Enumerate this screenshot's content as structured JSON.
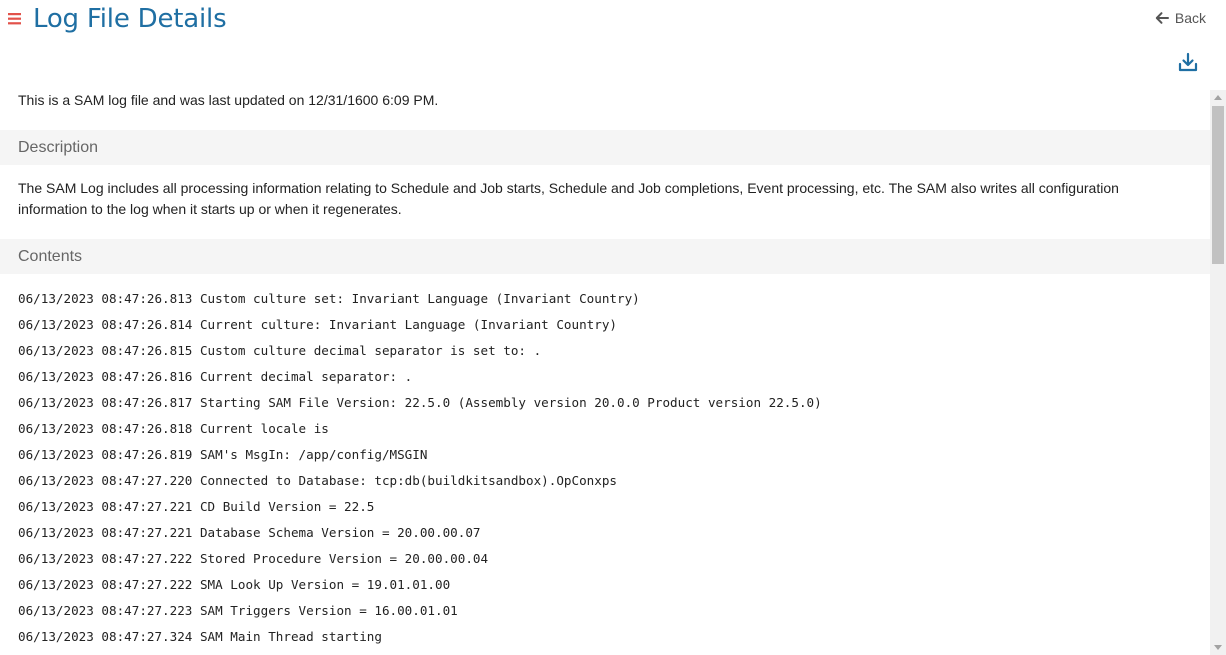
{
  "header": {
    "title": "Log File Details",
    "back_label": "Back",
    "title_color": "#1f6fa3",
    "menu_color": "#e2524a"
  },
  "summary": "This is a SAM log file and was last updated on 12/31/1600 6:09 PM.",
  "description": {
    "heading": "Description",
    "text": "The SAM Log includes all processing information relating to Schedule and Job starts, Schedule and Job completions, Event processing, etc. The SAM also writes all configuration information to the log when it starts up or when it regenerates."
  },
  "contents": {
    "heading": "Contents",
    "lines": [
      "06/13/2023 08:47:26.813 Custom culture set: Invariant Language (Invariant Country)",
      "06/13/2023 08:47:26.814 Current culture: Invariant Language (Invariant Country)",
      "06/13/2023 08:47:26.815 Custom culture decimal separator is set to: .",
      "06/13/2023 08:47:26.816 Current decimal separator: .",
      "06/13/2023 08:47:26.817 Starting SAM File Version: 22.5.0 (Assembly version 20.0.0 Product version 22.5.0)",
      "06/13/2023 08:47:26.818 Current locale is",
      "06/13/2023 08:47:26.819 SAM's MsgIn: /app/config/MSGIN",
      "06/13/2023 08:47:27.220 Connected to Database: tcp:db(buildkitsandbox).OpConxps",
      "06/13/2023 08:47:27.221 CD Build Version = 22.5",
      "06/13/2023 08:47:27.221 Database Schema Version = 20.00.00.07",
      "06/13/2023 08:47:27.222 Stored Procedure Version = 20.00.00.04",
      "06/13/2023 08:47:27.222 SMA Look Up Version = 19.01.01.00",
      "06/13/2023 08:47:27.223 SAM Triggers Version = 16.00.01.01",
      "06/13/2023 08:47:27.324 SAM Main Thread starting"
    ]
  },
  "icons": {
    "menu": "hamburger-menu-icon",
    "back": "arrow-left-icon",
    "download": "download-icon"
  }
}
